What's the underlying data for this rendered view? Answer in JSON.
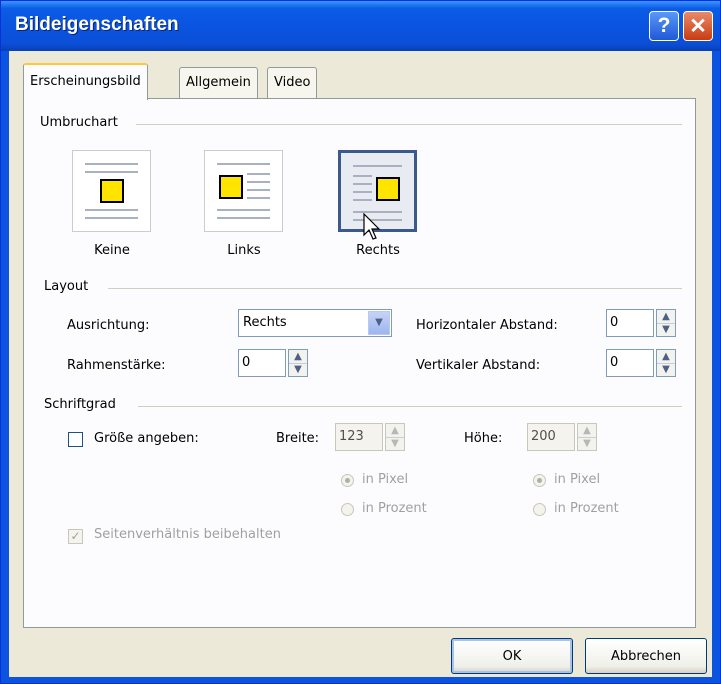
{
  "window": {
    "title": "Bildeigenschaften",
    "help_label": "?",
    "close_label": "✕"
  },
  "tabs": [
    {
      "label": "Erscheinungsbild",
      "active": true
    },
    {
      "label": "Allgemein",
      "active": false
    },
    {
      "label": "Video",
      "active": false
    }
  ],
  "groups": {
    "wrap": "Umbruchart",
    "layout": "Layout",
    "font": "Schriftgrad"
  },
  "wrap_options": [
    {
      "label": "Keine",
      "selected": false
    },
    {
      "label": "Links",
      "selected": false
    },
    {
      "label": "Rechts",
      "selected": true
    }
  ],
  "layout": {
    "alignment_label": "Ausrichtung:",
    "alignment_value": "Rechts",
    "border_label": "Rahmenstärke:",
    "border_value": "0",
    "hspace_label": "Horizontaler Abstand:",
    "hspace_value": "0",
    "vspace_label": "Vertikaler Abstand:",
    "vspace_value": "0"
  },
  "size": {
    "specify_label": "Größe angeben:",
    "specify_checked": false,
    "width_label": "Breite:",
    "width_value": "123",
    "height_label": "Höhe:",
    "height_value": "200",
    "unit_pixel": "in Pixel",
    "unit_percent": "in Prozent",
    "keep_ratio_label": "Seitenverhältnis beibehalten",
    "keep_ratio_checked": true
  },
  "buttons": {
    "ok": "OK",
    "cancel": "Abbrechen"
  },
  "colors": {
    "title_bar": "#0a54e0",
    "dialog_bg": "#ece9d8",
    "image_icon": "#ffe400"
  }
}
